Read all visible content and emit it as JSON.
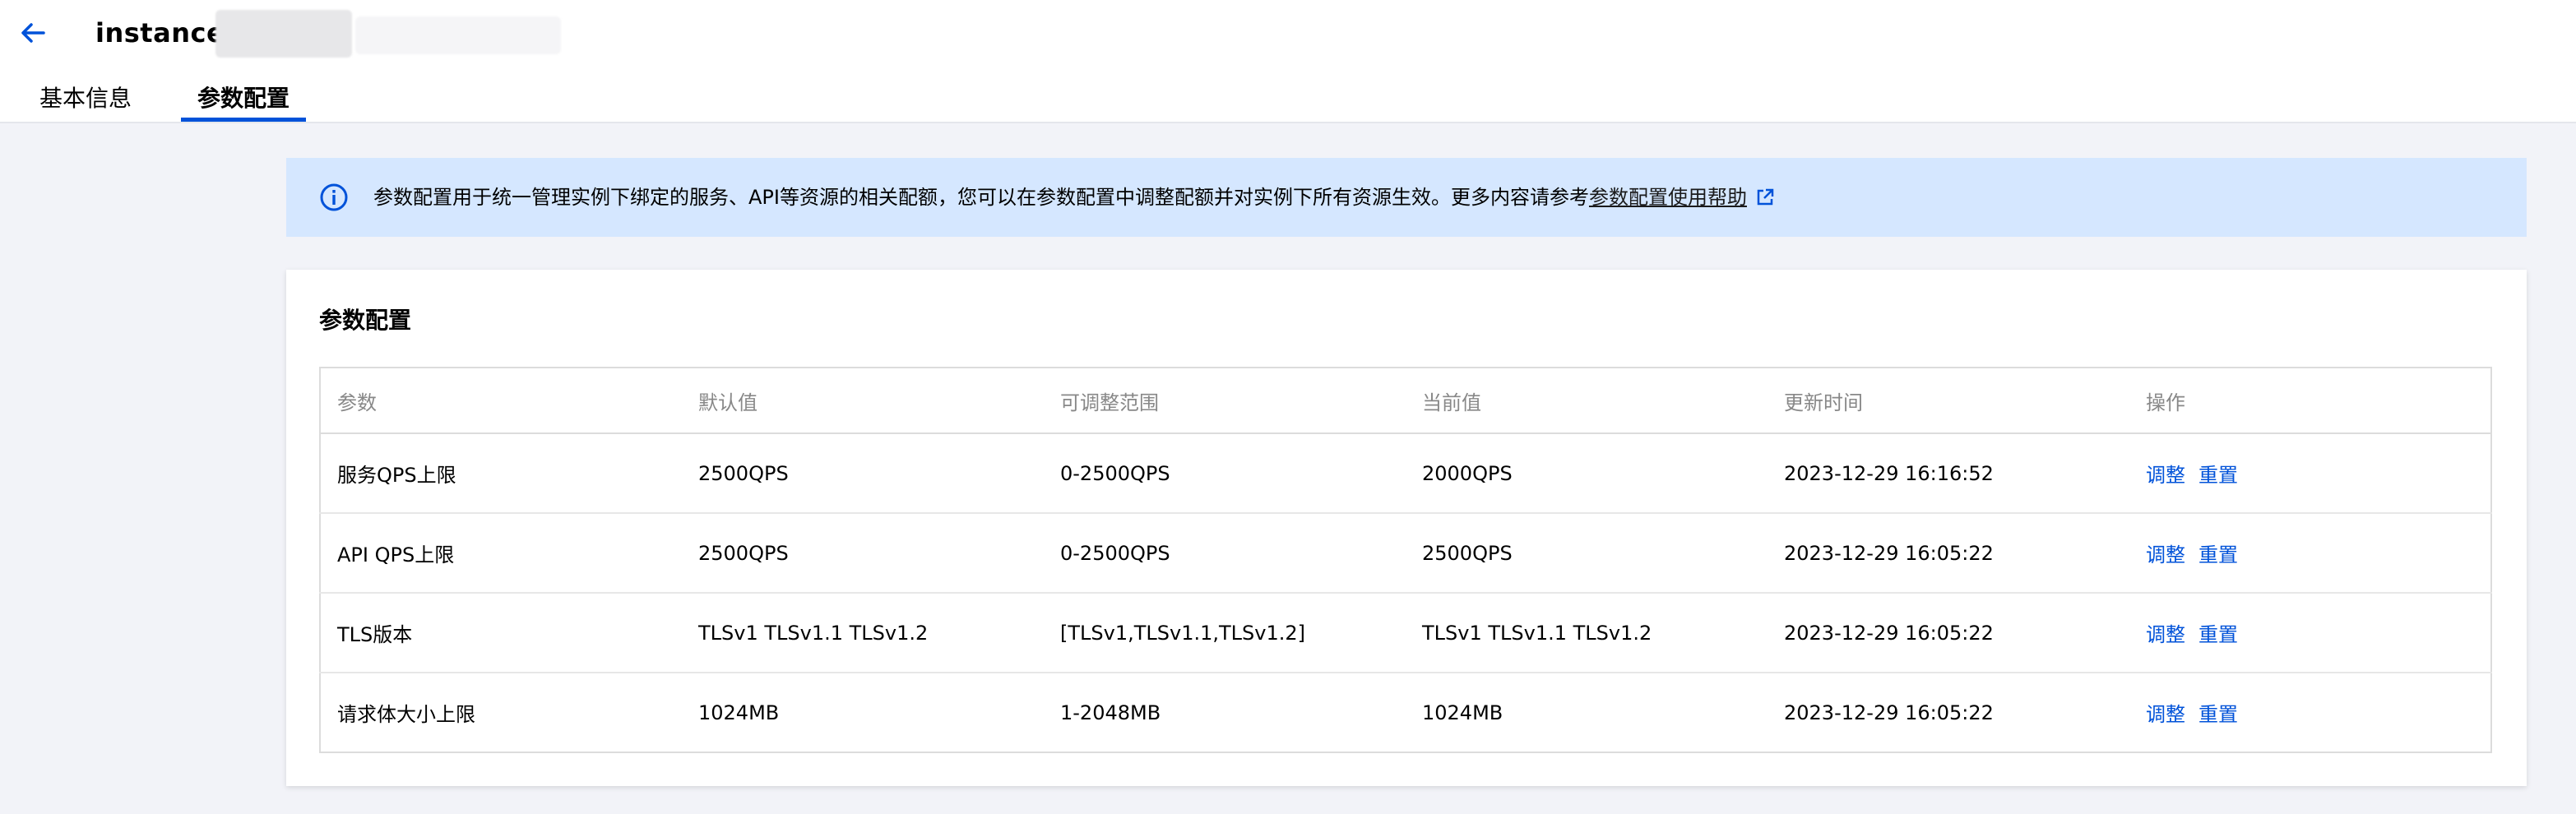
{
  "header": {
    "title": "instance-"
  },
  "tabs": [
    {
      "label": "基本信息",
      "active": false
    },
    {
      "label": "参数配置",
      "active": true
    }
  ],
  "banner": {
    "text": "参数配置用于统一管理实例下绑定的服务、API等资源的相关配额，您可以在参数配置中调整配额并对实例下所有资源生效。更多内容请参考",
    "link": "参数配置使用帮助"
  },
  "card": {
    "title": "参数配置",
    "columns": [
      "参数",
      "默认值",
      "可调整范围",
      "当前值",
      "更新时间",
      "操作"
    ],
    "rows": [
      {
        "param": "服务QPS上限",
        "default": "2500QPS",
        "range": "0-2500QPS",
        "current": "2000QPS",
        "updated": "2023-12-29 16:16:52",
        "adjust": "调整",
        "reset": "重置"
      },
      {
        "param": "API QPS上限",
        "default": "2500QPS",
        "range": "0-2500QPS",
        "current": "2500QPS",
        "updated": "2023-12-29 16:05:22",
        "adjust": "调整",
        "reset": "重置"
      },
      {
        "param": "TLS版本",
        "default": "TLSv1 TLSv1.1 TLSv1.2",
        "range": "[TLSv1,TLSv1.1,TLSv1.2]",
        "current": "TLSv1 TLSv1.1 TLSv1.2",
        "updated": "2023-12-29 16:05:22",
        "adjust": "调整",
        "reset": "重置"
      },
      {
        "param": "请求体大小上限",
        "default": "1024MB",
        "range": "1-2048MB",
        "current": "1024MB",
        "updated": "2023-12-29 16:05:22",
        "adjust": "调整",
        "reset": "重置"
      }
    ]
  },
  "colors": {
    "accent": "#0052d9",
    "banner_bg": "#d5e7ff",
    "page_bg": "#f2f3f8"
  },
  "icons": {
    "back": "arrow-left-icon",
    "info": "info-circle-icon",
    "external": "external-link-icon"
  }
}
